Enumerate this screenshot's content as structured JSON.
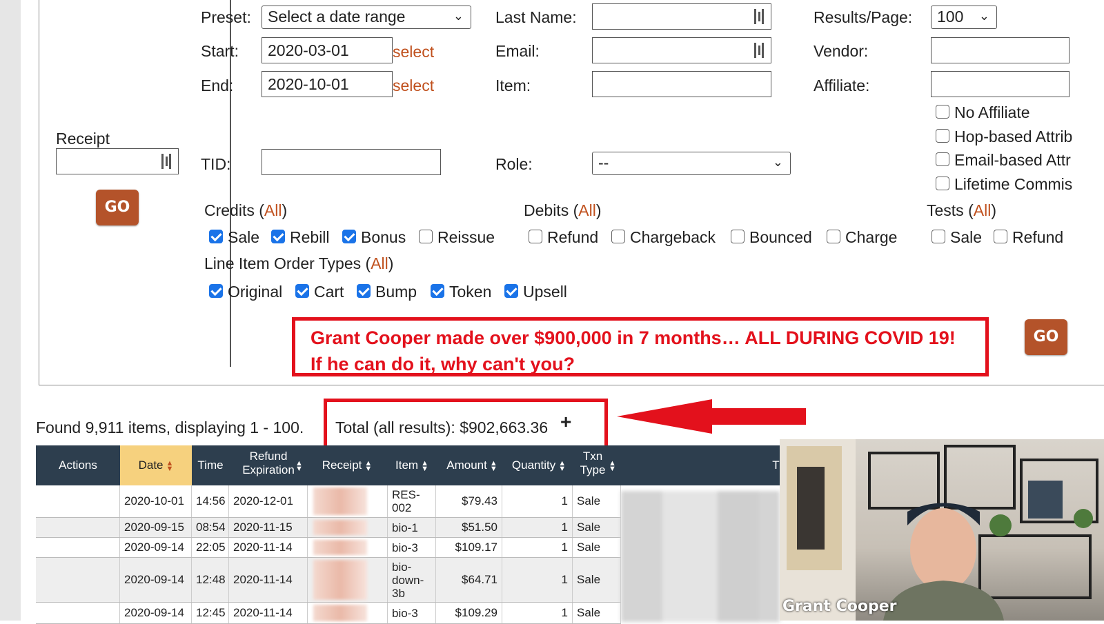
{
  "filters": {
    "receipt_label": "Receipt",
    "receipt_go": "GO",
    "preset_label": "Preset:",
    "preset_value": "Select a date range",
    "start_label": "Start:",
    "start_value": "2020-03-01",
    "end_label": "End:",
    "end_value": "2020-10-01",
    "select_link": "select",
    "last_name_label": "Last Name:",
    "email_label": "Email:",
    "item_label": "Item:",
    "results_label": "Results/Page:",
    "results_value": "100",
    "vendor_label": "Vendor:",
    "affiliate_label": "Affiliate:",
    "tid_label": "TID:",
    "role_label": "Role:",
    "role_value": "--",
    "affiliate_options": [
      {
        "label": "No Affiliate",
        "checked": false
      },
      {
        "label": "Hop-based Attrib",
        "checked": false
      },
      {
        "label": "Email-based Attr",
        "checked": false
      },
      {
        "label": "Lifetime Commis",
        "checked": false
      }
    ],
    "credits_title": "Credits",
    "debits_title": "Debits",
    "tests_title": "Tests",
    "line_items_title": "Line Item Order Types",
    "all_link": "All",
    "credits": [
      {
        "label": "Sale",
        "checked": true
      },
      {
        "label": "Rebill",
        "checked": true
      },
      {
        "label": "Bonus",
        "checked": true
      },
      {
        "label": "Reissue",
        "checked": false
      }
    ],
    "debits": [
      {
        "label": "Refund",
        "checked": false
      },
      {
        "label": "Chargeback",
        "checked": false
      },
      {
        "label": "Bounced",
        "checked": false
      },
      {
        "label": "Charge",
        "checked": false
      }
    ],
    "tests": [
      {
        "label": "Sale",
        "checked": false
      },
      {
        "label": "Refund",
        "checked": false
      }
    ],
    "line_items": [
      {
        "label": "Original",
        "checked": true
      },
      {
        "label": "Cart",
        "checked": true
      },
      {
        "label": "Bump",
        "checked": true
      },
      {
        "label": "Token",
        "checked": true
      },
      {
        "label": "Upsell",
        "checked": true
      }
    ],
    "main_go": "GO"
  },
  "promo": {
    "line1": "Grant Cooper made over $900,000 in 7 months… ALL DURING COVID 19!",
    "line2": "If he can do it, why can't you?",
    "color": "#e3111c"
  },
  "results": {
    "found_text": "Found 9,911 items, displaying 1 - 100.",
    "total_text": "Total (all results): $902,663.36",
    "plus": "+"
  },
  "table": {
    "headers": {
      "actions": "Actions",
      "date": "Date",
      "time": "Time",
      "refund_expiration": "Refund Expiration",
      "receipt": "Receipt",
      "item": "Item",
      "amount": "Amount",
      "quantity": "Quantity",
      "txn_type": "Txn Type",
      "extra": "Ti"
    },
    "rows": [
      {
        "date": "2020-10-01",
        "time": "14:56",
        "refund": "2020-12-01",
        "item": "RES-002",
        "amount": "$79.43",
        "qty": "1",
        "type": "Sale"
      },
      {
        "date": "2020-09-15",
        "time": "08:54",
        "refund": "2020-11-15",
        "item": "bio-1",
        "amount": "$51.50",
        "qty": "1",
        "type": "Sale"
      },
      {
        "date": "2020-09-14",
        "time": "22:05",
        "refund": "2020-11-14",
        "item": "bio-3",
        "amount": "$109.17",
        "qty": "1",
        "type": "Sale"
      },
      {
        "date": "2020-09-14",
        "time": "12:48",
        "refund": "2020-11-14",
        "item": "bio-down-3b",
        "amount": "$64.71",
        "qty": "1",
        "type": "Sale"
      },
      {
        "date": "2020-09-14",
        "time": "12:45",
        "refund": "2020-11-14",
        "item": "bio-3",
        "amount": "$109.29",
        "qty": "1",
        "type": "Sale"
      }
    ]
  },
  "video": {
    "name": "Grant Cooper"
  }
}
